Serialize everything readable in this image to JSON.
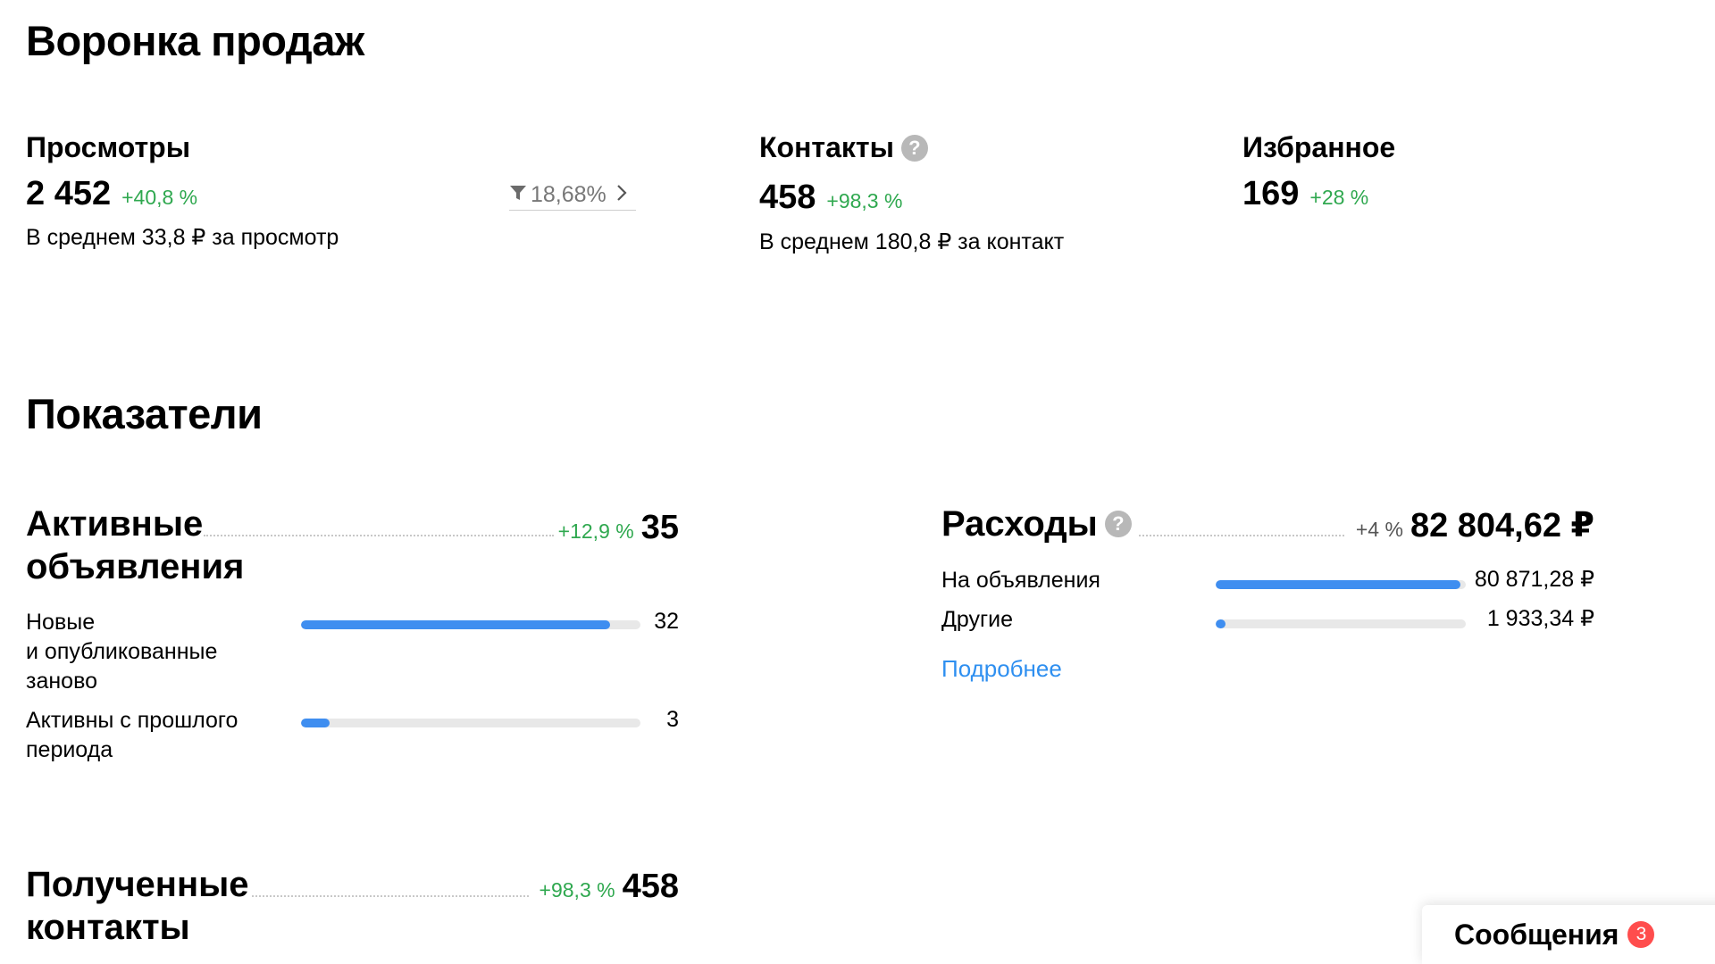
{
  "funnel": {
    "title": "Воронка продаж",
    "views": {
      "title": "Просмотры",
      "value": "2 452",
      "delta": "+40,8 %",
      "avg": "В среднем 33,8 ₽ за просмотр",
      "conversion": "18,68%"
    },
    "contacts": {
      "title": "Контакты",
      "help": "?",
      "value": "458",
      "delta": "+98,3 %",
      "avg": "В среднем 180,8 ₽ за контакт"
    },
    "favorites": {
      "title": "Избранное",
      "value": "169",
      "delta": "+28 %"
    }
  },
  "indicators": {
    "title": "Показатели",
    "active_ads": {
      "title_line1": "Активные",
      "title_line2": "объявления",
      "delta": "+12,9 %",
      "value": "35",
      "rows": [
        {
          "label_lines": [
            "Новые",
            "и опубликованные",
            "заново"
          ],
          "value": "32",
          "fill": 0.91
        },
        {
          "label_lines": [
            "Активны с прошлого",
            "периода"
          ],
          "value": "3",
          "fill": 0.085
        }
      ]
    },
    "expenses": {
      "title": "Расходы",
      "help": "?",
      "delta": "+4 %",
      "value": "82 804,62 ₽",
      "rows": [
        {
          "label": "На объявления",
          "value": "80 871,28 ₽",
          "fill": 0.977
        },
        {
          "label": "Другие",
          "value": "1 933,34 ₽",
          "fill": 0.04
        }
      ],
      "more_link": "Подробнее"
    },
    "received_contacts": {
      "title_line1": "Полученные",
      "title_line2": "контакты",
      "delta": "+98,3 %",
      "value": "458"
    }
  },
  "messages": {
    "label": "Сообщения",
    "count": "3"
  },
  "colors": {
    "positive": "#2fa84f",
    "bar": "#3f8ef0",
    "link": "#2e8ff0",
    "badge": "#ff4d4d"
  }
}
